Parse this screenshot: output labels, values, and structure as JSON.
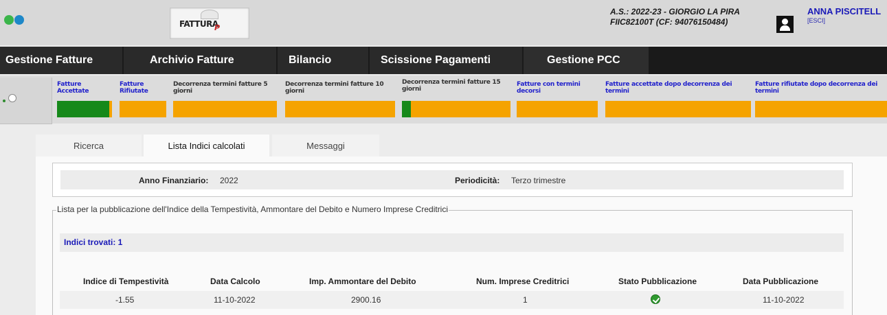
{
  "header": {
    "school_line1": "A.S.: 2022-23 - GIORGIO LA PIRA",
    "school_line2": "FIIC82100T (CF: 94076150484)",
    "user_name": "ANNA PISCITELL",
    "logout_label": "[ESCI]",
    "logo_text": "FATTURA",
    "logo_pa": "P"
  },
  "menu": [
    {
      "label": "Gestione Fatture"
    },
    {
      "label": "Archivio Fatture"
    },
    {
      "label": "Bilancio"
    },
    {
      "label": "Scissione Pagamenti"
    },
    {
      "label": "Gestione PCC"
    }
  ],
  "status": [
    {
      "label": "Fatture Accettate",
      "fill": 0.95
    },
    {
      "label": "Fatture Rifiutate",
      "fill": 0
    },
    {
      "label": "Decorrenza termini fatture 5 giorni",
      "fill": 0
    },
    {
      "label": "Decorrenza termini fatture 10 giorni",
      "fill": 0
    },
    {
      "label": "Decorrenza termini fatture 15 giorni",
      "fill": 0.08
    },
    {
      "label": "Fatture con termini decorsi",
      "fill": 0
    },
    {
      "label": "Fatture accettate dopo decorrenza dei termini",
      "fill": 0
    },
    {
      "label": "Fatture rifiutate dopo decorrenza dei termini",
      "fill": 0
    }
  ],
  "colors": {
    "bar": "#f5a300",
    "fill": "#16891a",
    "link": "#1a1ab8"
  },
  "tabs": [
    {
      "label": "Ricerca"
    },
    {
      "label": "Lista Indici calcolati",
      "active": true
    },
    {
      "label": "Messaggi"
    }
  ],
  "params": {
    "anno_label": "Anno Finanziario:",
    "anno_value": "2022",
    "periodicita_label": "Periodicità:",
    "periodicita_value": "Terzo trimestre"
  },
  "list": {
    "legend": "Lista per la pubblicazione dell'Indice della Tempestività, Ammontare del Debito e Numero Imprese Creditrici",
    "found": "Indici trovati: 1",
    "columns": [
      "Indice di Tempestività",
      "Data Calcolo",
      "Imp. Ammontare del Debito",
      "Num. Imprese Creditrici",
      "Stato Pubblicazione",
      "Data Pubblicazione"
    ],
    "rows": [
      {
        "indice": "-1.55",
        "data_calcolo": "11-10-2022",
        "importo": "2900.16",
        "num_imprese": "1",
        "stato_icon": "check-circle-icon",
        "data_pubblicazione": "11-10-2022"
      }
    ]
  }
}
